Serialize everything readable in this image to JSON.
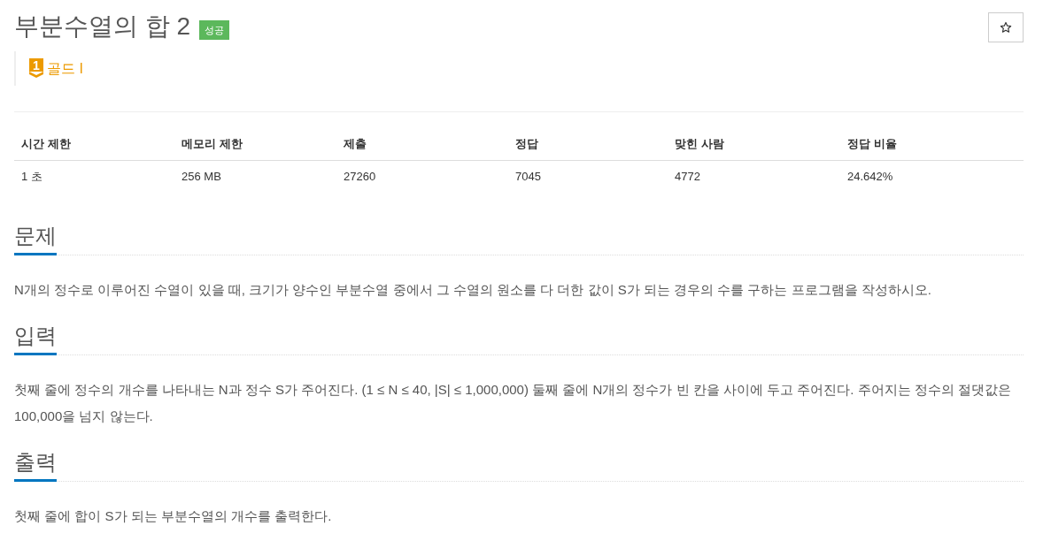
{
  "title": "부분수열의 합 2",
  "result_badge": "성공",
  "tier": {
    "badge_number": "1",
    "label": "골드 I"
  },
  "info_table": {
    "columns": [
      "시간 제한",
      "메모리 제한",
      "제출",
      "정답",
      "맞힌 사람",
      "정답 비율"
    ],
    "rows": [
      [
        "1 초",
        "256 MB",
        "27260",
        "7045",
        "4772",
        "24.642%"
      ]
    ]
  },
  "sections": [
    {
      "heading": "문제",
      "paragraph": "N개의 정수로 이루어진 수열이 있을 때, 크기가 양수인 부분수열 중에서 그 수열의 원소를 다 더한 값이 S가 되는 경우의 수를 구하는 프로그램을 작성하시오."
    },
    {
      "heading": "입력",
      "paragraph": "첫째 줄에 정수의 개수를 나타내는 N과 정수 S가 주어진다. (1 ≤ N ≤ 40, |S| ≤ 1,000,000) 둘째 줄에 N개의 정수가 빈 칸을 사이에 두고 주어진다. 주어지는 정수의 절댓값은 100,000을 넘지 않는다."
    },
    {
      "heading": "출력",
      "paragraph": "첫째 줄에 합이 S가 되는 부분수열의 개수를 출력한다."
    }
  ]
}
